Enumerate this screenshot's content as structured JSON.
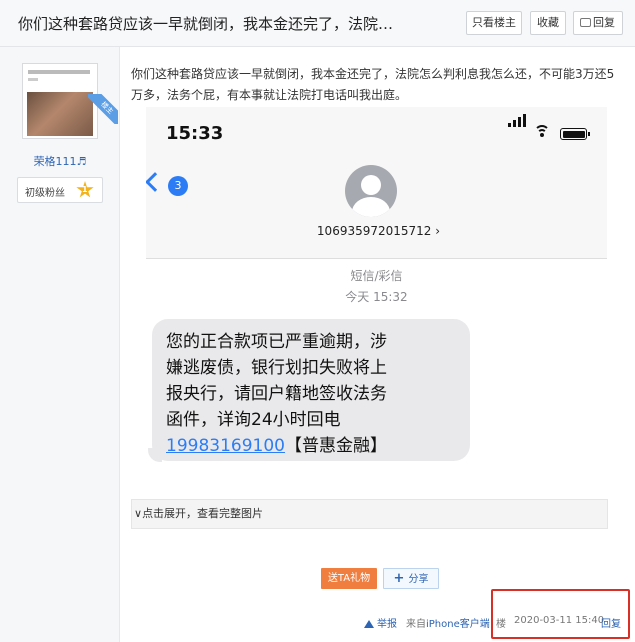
{
  "header": {
    "title": "你们这种套路贷应该一早就倒闭，我本金还完了，法院…",
    "buttons": {
      "only_op": "只看楼主",
      "favorite": "收藏",
      "reply": "回复"
    }
  },
  "author": {
    "ribbon": "楼主",
    "username": "荣格111♬",
    "badge_label": "初级粉丝",
    "level": "1"
  },
  "post": {
    "text": "你们这种套路贷应该一早就倒闭，我本金还完了，法院怎么判利息我怎么还，不可能3万还5万多，法务个屁，有本事就让法院打电话叫我出庭。"
  },
  "screenshot": {
    "time": "15:33",
    "back_count": "3",
    "sender_number": "106935972015712 ›",
    "message_type": "短信/彩信",
    "message_time": "今天 15:32",
    "message_lines": [
      "您的正合款项已严重逾期，涉",
      "嫌逃废债，银行划扣失败将上",
      "报央行，请回户籍地签收法务",
      "函件，详询24小时回电"
    ],
    "message_phone": "19983169100",
    "message_tail": "【普惠金融】"
  },
  "expand": {
    "label": "点击展开，查看完整图片"
  },
  "actions": {
    "gift": "送TA礼物",
    "share": "分享"
  },
  "footer": {
    "report": "举报",
    "source_prefix": "来自",
    "source_client": "iPhone客户端",
    "floor": "楼",
    "date": "2020-03-11 15:40",
    "reply": "回复"
  },
  "colors": {
    "link": "#2d64b3",
    "gift": "#f07e3e",
    "highlight_box": "#d93025",
    "ios_blue": "#2c7df5"
  }
}
